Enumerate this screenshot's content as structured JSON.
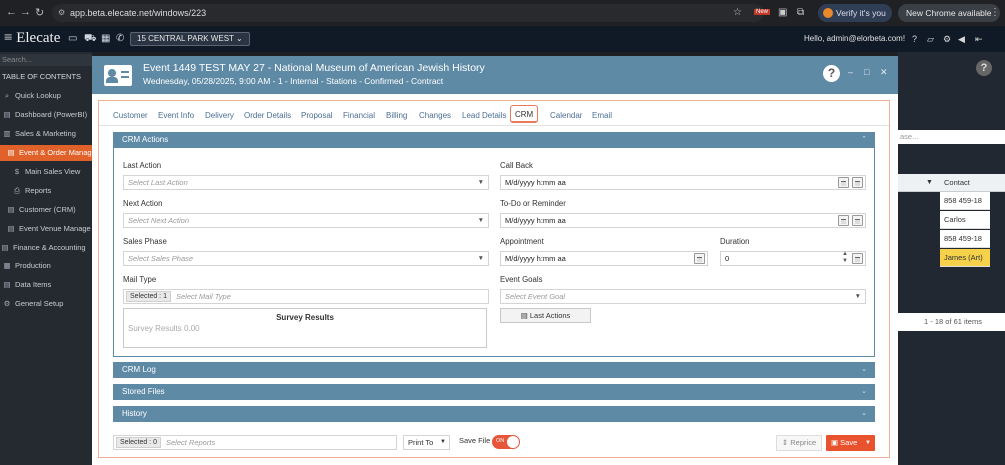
{
  "browser": {
    "url": "app.beta.elecate.net/windows/223",
    "verify_label": "Verify it's you",
    "update_label": "New Chrome available",
    "new_badge": "New"
  },
  "app": {
    "logo": "Elecate",
    "location": "15 CENTRAL PARK WEST",
    "greeting": "Hello, admin@elorbeta.com!"
  },
  "sidebar": {
    "search_placeholder": "Search...",
    "toc": "TABLE OF CONTENTS",
    "items": [
      {
        "label": "Quick Lookup",
        "icon": "search-icon"
      },
      {
        "label": "Dashboard (PowerBI)",
        "icon": "dashboard-icon"
      },
      {
        "label": "Sales & Marketing",
        "icon": "sales-icon"
      },
      {
        "label": "Event & Order Manag",
        "icon": "event-icon",
        "active": true
      },
      {
        "label": "Main Sales View",
        "icon": "dollar-icon"
      },
      {
        "label": "Reports",
        "icon": "print-icon"
      },
      {
        "label": "Customer (CRM)",
        "icon": "customer-icon"
      },
      {
        "label": "Event Venue Manage",
        "icon": "venue-icon"
      },
      {
        "label": "Finance & Accounting",
        "icon": "finance-icon"
      },
      {
        "label": "Production",
        "icon": "production-icon"
      },
      {
        "label": "Data Items",
        "icon": "data-icon"
      },
      {
        "label": "General Setup",
        "icon": "setup-icon"
      }
    ]
  },
  "background_grid": {
    "column_header": "Contact",
    "cells": [
      "858 459-18",
      "Carlos",
      "858 459-18",
      "James (Art)"
    ],
    "items_text": "1 - 18 of 61 items",
    "partial_text": "ase..."
  },
  "modal": {
    "title": "Event 1449 TEST MAY 27 - National Museum of American Jewish History",
    "subtitle": "Wednesday, 05/28/2025, 9:00 AM - 1 - Internal - Stations - Confirmed - Contract",
    "tabs": [
      "Customer",
      "Event Info",
      "Delivery",
      "Order Details",
      "Proposal",
      "Financial",
      "Billing",
      "Changes",
      "Lead Details",
      "CRM",
      "Calendar",
      "Email"
    ],
    "active_tab": "CRM",
    "sections": {
      "crm_actions": "CRM Actions",
      "crm_log": "CRM Log",
      "stored_files": "Stored Files",
      "history": "History"
    },
    "form": {
      "last_action_label": "Last Action",
      "last_action_placeholder": "Select Last Action",
      "next_action_label": "Next Action",
      "next_action_placeholder": "Select Next Action",
      "sales_phase_label": "Sales Phase",
      "sales_phase_placeholder": "Select Sales Phase",
      "mail_type_label": "Mail Type",
      "mail_type_chip": "Selected : 1",
      "mail_type_placeholder": "Select Mail Type",
      "call_back_label": "Call Back",
      "call_back_value": "M/d/yyyy h:mm aa",
      "todo_label": "To-Do or Reminder",
      "todo_value": "M/d/yyyy h:mm aa",
      "appointment_label": "Appointment",
      "appointment_value": "M/d/yyyy h:mm aa",
      "duration_label": "Duration",
      "duration_value": "0",
      "event_goals_label": "Event Goals",
      "event_goals_placeholder": "Select Event Goal",
      "last_actions_button": "Last Actions",
      "survey_title": "Survey Results",
      "survey_result": "Survey Results 0.00"
    },
    "footer": {
      "reports_chip": "Selected : 0",
      "reports_placeholder": "Select Reports",
      "print_label": "Print To",
      "save_file_label": "Save File",
      "toggle_text": "ON",
      "reprice_label": "Reprice",
      "save_label": "Save"
    }
  }
}
